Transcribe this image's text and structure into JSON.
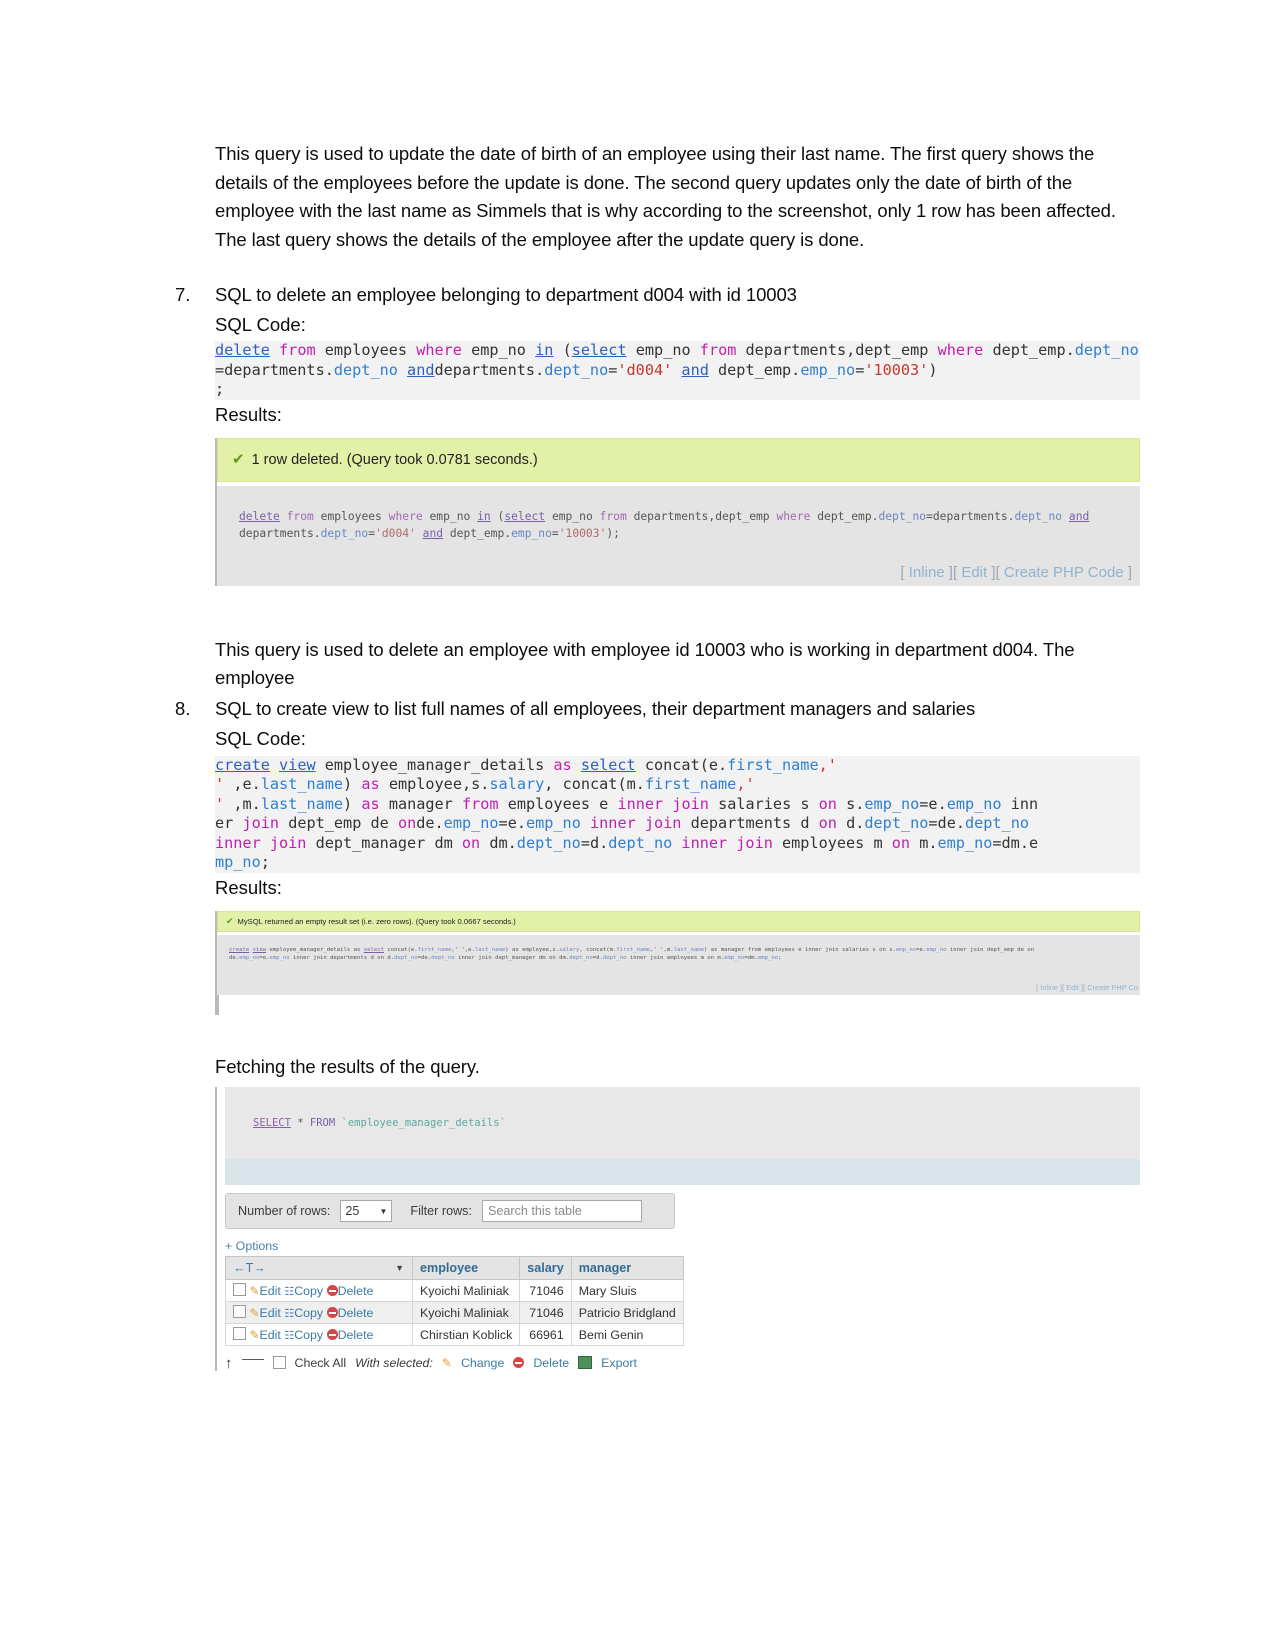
{
  "intro_paragraph": "This query is used to update the date of birth of an employee using their last name. The first query shows the details of the employees before the update is done. The second query updates only the date of birth of the employee with the last name as Simmels that is why according to the screenshot, only 1 row has been affected. The last query shows the details of the employee after the update query is done.",
  "item7": {
    "number": "7.",
    "heading": "SQL to delete an employee belonging to department d004 with id 10003",
    "sql_code_label": "SQL Code:",
    "results_label": "Results:",
    "sql_code": "delete from employees where emp_no in (select emp_no from departments,dept_emp where dept_emp.dept_no=departments.dept_no anddepartments.dept_no='d004' and dept_emp.emp_no='10003');",
    "result_message": "1 row deleted. (Query took 0.0781 seconds.)",
    "echo_query": "delete from employees where emp_no in (select emp_no from departments,dept_emp where dept_emp.dept_no=departments.dept_no and departments.dept_no='d004' and dept_emp.emp_no='10003');",
    "links": [
      "Inline",
      "Edit",
      "Create PHP Code"
    ],
    "explanation": "This query is used to delete an employee with employee id 10003 who is working in department d004. The employee"
  },
  "item8": {
    "number": "8.",
    "heading": "SQL to create view to list full names of all employees, their department managers and salaries",
    "sql_code_label": "SQL Code:",
    "results_label": "Results:",
    "sql_code": "create view employee_manager_details as select concat(e.first_name,' ',e.last_name) as employee,s.salary, concat(m.first_name,' ',m.last_name) as manager from employees e inner join salaries s on s.emp_no=e.emp_no inner join dept_emp de onde.emp_no=e.emp_no inner join departments d on d.dept_no=de.dept_no inner join dept_manager dm on dm.dept_no=d.dept_no inner join employees m on m.emp_no=dm.emp_no;",
    "result_message": "MySQL returned an empty result set (i.e. zero rows). (Query took 0.0667 seconds.)",
    "links": [
      "Inline",
      "Edit",
      "Create PHP Co"
    ],
    "fetch_caption": "Fetching the results of the query."
  },
  "table_shot": {
    "query": "SELECT * FROM `employee_manager_details`",
    "rows_label": "Number of rows:",
    "rows_value": "25",
    "filter_label": "Filter rows:",
    "filter_placeholder": "Search this table",
    "options_label": "+ Options",
    "sort_header": "←T→",
    "columns": [
      "employee",
      "salary",
      "manager"
    ],
    "actions": [
      "Edit",
      "Copy",
      "Delete"
    ],
    "rows": [
      {
        "employee": "Kyoichi Maliniak",
        "salary": "71046",
        "manager": "Mary Sluis"
      },
      {
        "employee": "Kyoichi Maliniak",
        "salary": "71046",
        "manager": "Patricio Bridgland"
      },
      {
        "employee": "Chirstian Koblick",
        "salary": "66961",
        "manager": "Bemi Genin"
      }
    ],
    "check_all": "Check All",
    "with_selected": "With selected:",
    "footer_actions": [
      "Change",
      "Delete",
      "Export"
    ]
  }
}
